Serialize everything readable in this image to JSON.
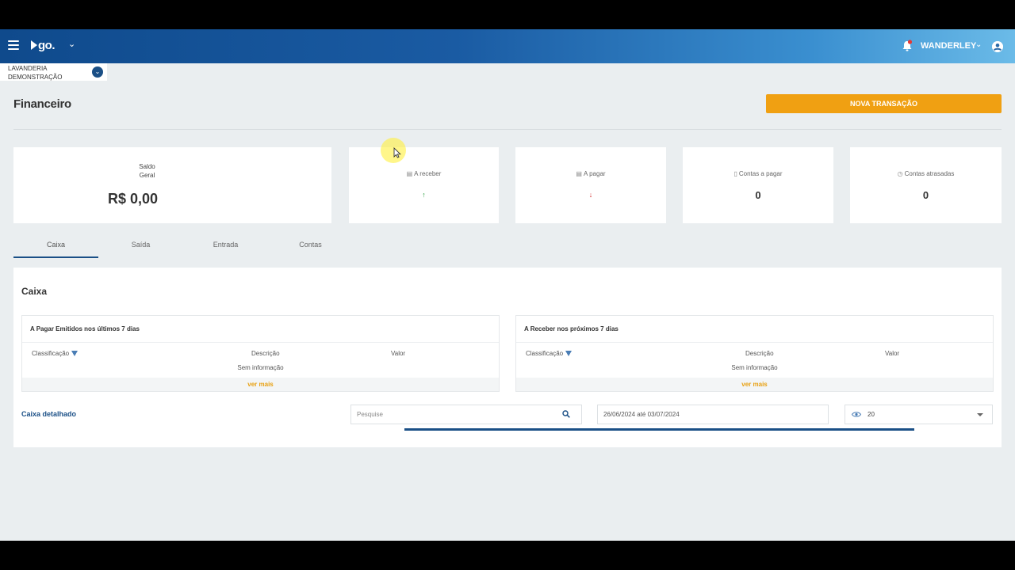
{
  "header": {
    "logo_text": "go.",
    "username": "WANDERLEY"
  },
  "company": {
    "line1": "LAVANDERIA",
    "line2": "DEMONSTRAÇÃO"
  },
  "page": {
    "title": "Financeiro",
    "new_transaction_label": "NOVA TRANSAÇÃO"
  },
  "cards": {
    "saldo": {
      "label_line1": "Saldo",
      "label_line2": "Geral",
      "value": "R$ 0,00"
    },
    "receber": {
      "label": "A receber",
      "arrow": "↑",
      "arrow_color": "#2ea043"
    },
    "pagar": {
      "label": "A pagar",
      "arrow": "↓",
      "arrow_color": "#d32f2f"
    },
    "contas_pagar": {
      "label": "Contas a pagar",
      "value": "0"
    },
    "contas_atrasadas": {
      "label": "Contas atrasadas",
      "value": "0"
    }
  },
  "tabs": [
    {
      "label": "Caixa",
      "active": true
    },
    {
      "label": "Saída",
      "active": false
    },
    {
      "label": "Entrada",
      "active": false
    },
    {
      "label": "Contas",
      "active": false
    }
  ],
  "panel": {
    "title": "Caixa",
    "pagar_table": {
      "title": "A Pagar Emitidos nos últimos 7 dias",
      "columns": [
        "Classificação",
        "Descrição",
        "Valor"
      ],
      "empty_text": "Sem informação",
      "more_label": "ver mais"
    },
    "receber_table": {
      "title": "A Receber nos próximos 7 dias",
      "columns": [
        "Classificação",
        "Descrição",
        "Valor"
      ],
      "empty_text": "Sem informação",
      "more_label": "ver mais"
    },
    "detalhado_label": "Caixa detalhado",
    "search_placeholder": "Pesquise",
    "date_range": "26/06/2024 até 03/07/2024",
    "page_size": "20"
  },
  "colors": {
    "primary": "#1a4f86",
    "accent": "#f0a012"
  }
}
